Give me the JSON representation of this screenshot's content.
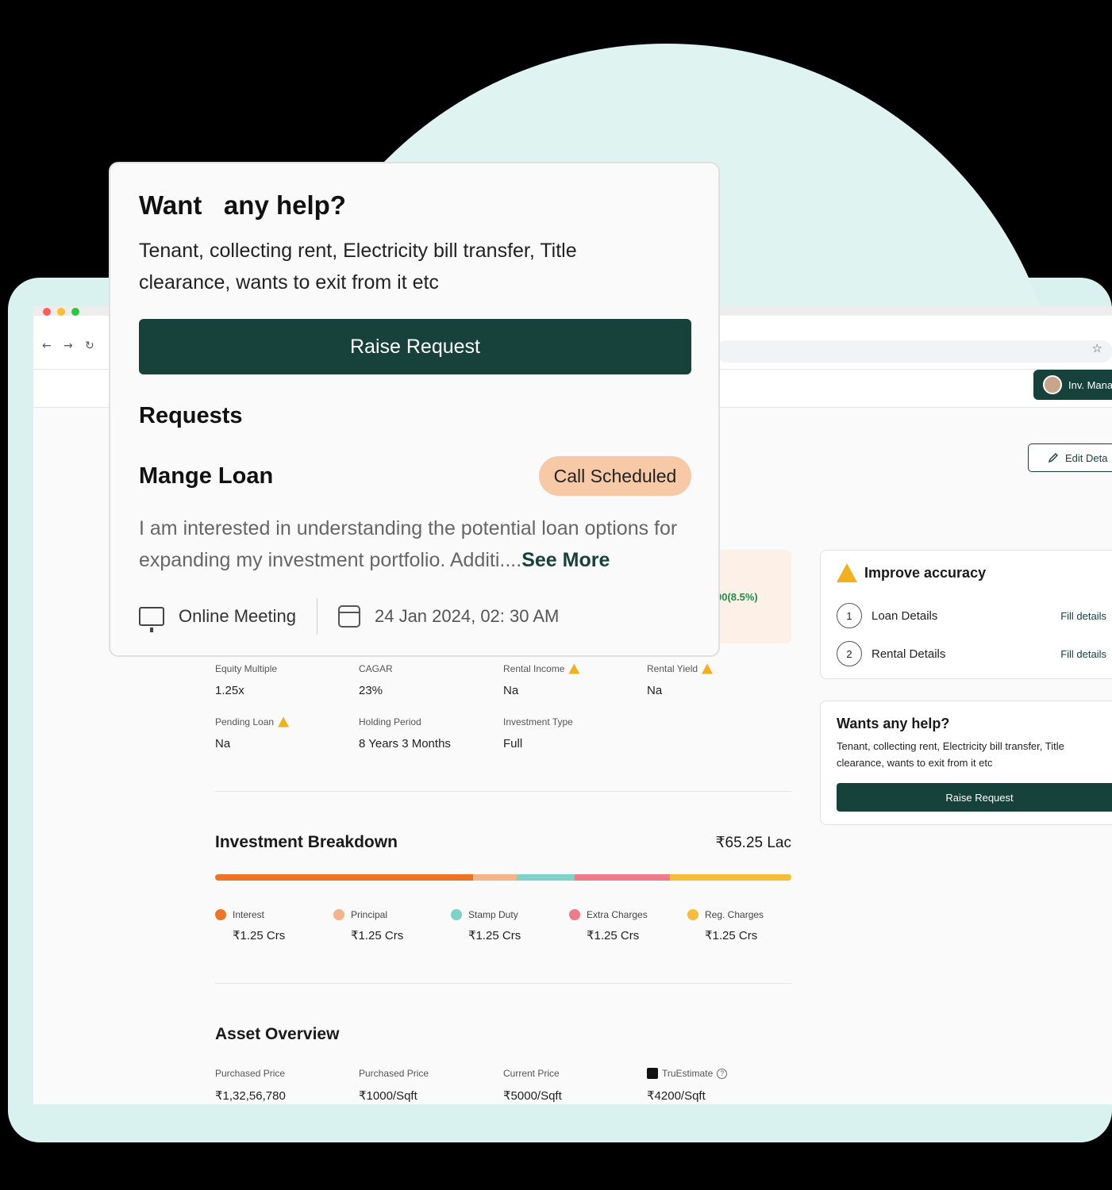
{
  "browser": {
    "nav": {
      "back": "←",
      "forward": "→",
      "reload": "↻",
      "bookmark": "☆"
    }
  },
  "header": {
    "user_button": "Inv. Mana",
    "edit_button": "Edit Deta"
  },
  "highlight_value": "00(8.5%)",
  "metrics": {
    "equity_multiple": {
      "label": "Equity Multiple",
      "value": "1.25x"
    },
    "cagar": {
      "label": "CAGAR",
      "value": "23%"
    },
    "rental_income": {
      "label": "Rental Income",
      "value": "Na"
    },
    "rental_yield": {
      "label": "Rental Yield",
      "value": "Na"
    },
    "pending_loan": {
      "label": "Pending Loan",
      "value": "Na"
    },
    "holding_period": {
      "label": "Holding Period",
      "value": "8 Years 3 Months"
    },
    "investment_type": {
      "label": "Investment Type",
      "value": "Full"
    }
  },
  "investment_breakdown": {
    "title": "Investment Breakdown",
    "total": "₹65.25 Lac",
    "segments": [
      {
        "name": "Interest",
        "value": "₹1.25 Crs",
        "color": "#ee7425",
        "share": 0.448
      },
      {
        "name": "Principal",
        "value": "₹1.25 Crs",
        "color": "#f3b48c",
        "share": 0.076
      },
      {
        "name": "Stamp Duty",
        "value": "₹1.25 Crs",
        "color": "#7dd3c8",
        "share": 0.1
      },
      {
        "name": "Extra Charges",
        "value": "₹1.25 Crs",
        "color": "#ee7a8a",
        "share": 0.165
      },
      {
        "name": "Reg. Charges",
        "value": "₹1.25 Crs",
        "color": "#f5bd3a",
        "share": 0.211
      }
    ]
  },
  "asset_overview": {
    "title": "Asset Overview",
    "items": [
      {
        "label": "Purchased Price",
        "value": "₹1,32,56,780"
      },
      {
        "label": "Purchased Price",
        "value": "₹1000/Sqft"
      },
      {
        "label": "Current Price",
        "value": "₹5000/Sqft"
      },
      {
        "label": "TruEstimate",
        "value": "₹4200/Sqft"
      }
    ],
    "info_icon": "?"
  },
  "improve_accuracy": {
    "title": "Improve accuracy",
    "rows": [
      {
        "num": "1",
        "label": "Loan Details",
        "action": "Fill details"
      },
      {
        "num": "2",
        "label": "Rental Details",
        "action": "Fill details"
      }
    ]
  },
  "help_card": {
    "title": "Wants any help?",
    "body": "Tenant, collecting rent, Electricity bill transfer, Title clearance, wants to exit from it etc",
    "button": "Raise Request"
  },
  "popup": {
    "title": "Want   any help?",
    "subtitle": "Tenant, collecting rent, Electricity bill transfer, Title clearance, wants to exit from it etc",
    "button": "Raise Request",
    "requests_heading": "Requests",
    "request": {
      "title": "Mange Loan",
      "status": "Call Scheduled",
      "description": "I am interested in understanding the potential loan options for expanding my investment portfolio. Additi....",
      "see_more": "See More",
      "meeting_type": "Online Meeting",
      "datetime": "24 Jan 2024, 02: 30 AM"
    }
  },
  "colors": {
    "accent": "#17423b",
    "badge": "#f8c9a6",
    "warning": "#f2b01e"
  }
}
